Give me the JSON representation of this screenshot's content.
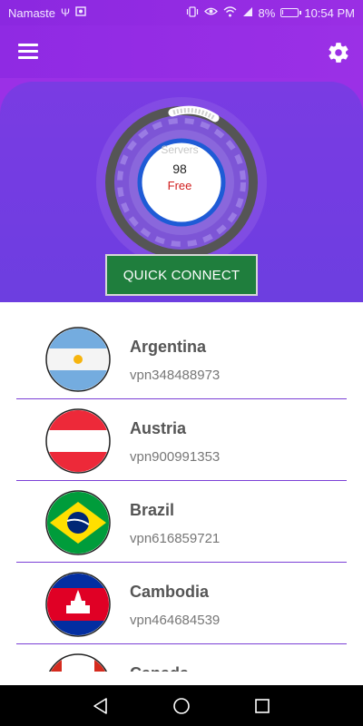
{
  "status_bar": {
    "carrier": "Namaste",
    "battery": "8%",
    "battery_level": 0.08,
    "time": "10:54 PM",
    "icons": [
      "usb-icon",
      "photo-icon",
      "vibrate-icon",
      "eye-icon",
      "wifi-icon",
      "signal-icon",
      "battery-icon"
    ]
  },
  "app_bar": {
    "menu_icon": "hamburger-menu-icon",
    "settings_icon": "gear-icon"
  },
  "colors": {
    "primary": "#9b30e6",
    "panel": "#6c3ee0",
    "connect_button": "#1f7e3d",
    "free_text": "#d01c1c",
    "gauge_ring": "#1e5bd6"
  },
  "gauge": {
    "label": "Servers",
    "count": "98",
    "tier": "Free"
  },
  "quick_connect": {
    "label": "QUICK CONNECT"
  },
  "servers": [
    {
      "country": "Argentina",
      "id": "vpn348488973",
      "flag": "argentina-flag"
    },
    {
      "country": "Austria",
      "id": "vpn900991353",
      "flag": "austria-flag"
    },
    {
      "country": "Brazil",
      "id": "vpn616859721",
      "flag": "brazil-flag"
    },
    {
      "country": "Cambodia",
      "id": "vpn464684539",
      "flag": "cambodia-flag"
    },
    {
      "country": "Canada",
      "id": "",
      "flag": "canada-flag"
    }
  ],
  "nav_bar": {
    "back_icon": "back-triangle-icon",
    "home_icon": "home-circle-icon",
    "recents_icon": "recents-square-icon"
  }
}
